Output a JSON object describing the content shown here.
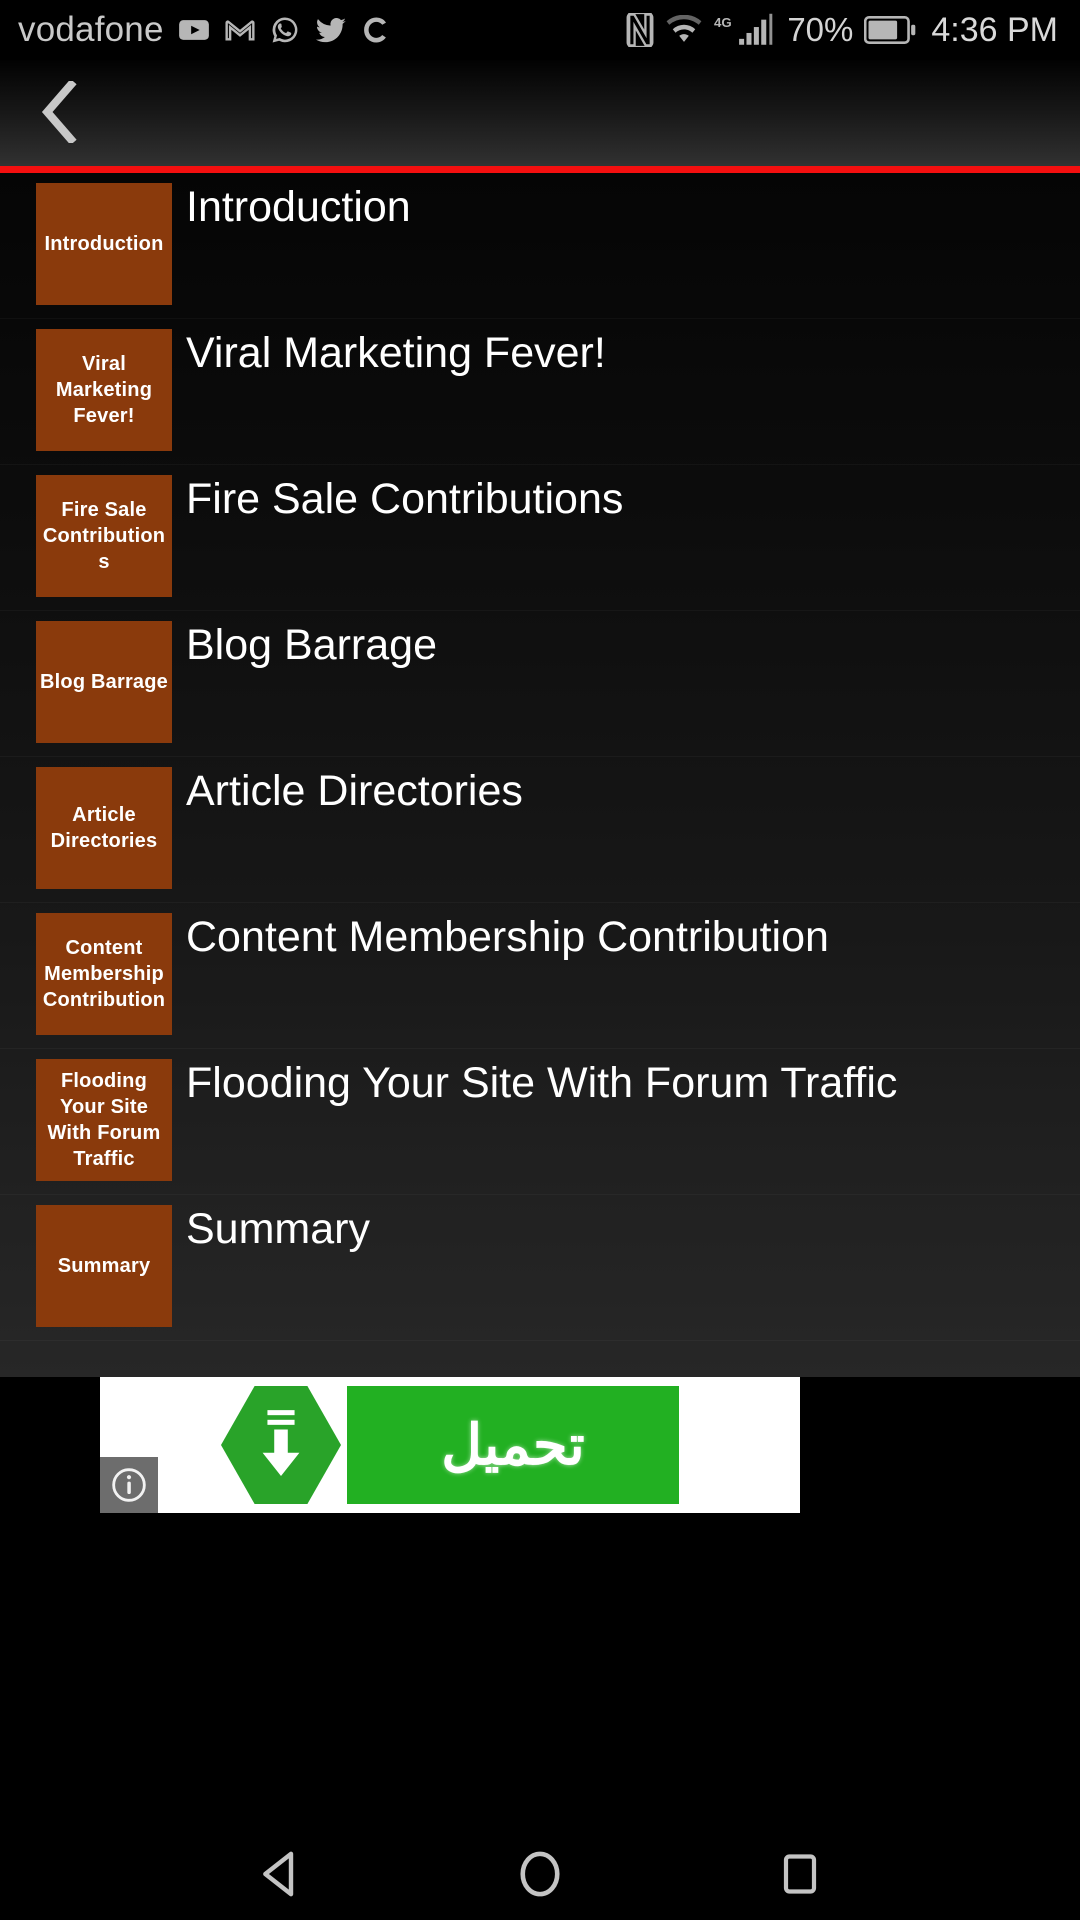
{
  "status_bar": {
    "carrier": "vodafone",
    "icons": [
      "youtube-icon",
      "gmail-icon",
      "whatsapp-icon",
      "twitter-icon",
      "chrome-c-icon"
    ],
    "right_icons": [
      "nfc-icon",
      "wifi-icon",
      "signal-4g-icon",
      "battery-icon"
    ],
    "network": "4G",
    "battery_percent": "70%",
    "time": "4:36 PM"
  },
  "app_bar": {
    "back_icon": "chevron-left-icon",
    "accent_color": "#f40f0f"
  },
  "colors": {
    "thumb_bg": "#8a3a0c",
    "accent_red": "#f40f0f",
    "ad_green": "#22b022"
  },
  "chapters": [
    {
      "thumb_label": "Introduction",
      "title": "Introduction"
    },
    {
      "thumb_label": "Viral Marketing Fever!",
      "title": "Viral Marketing Fever!"
    },
    {
      "thumb_label": "Fire Sale Contributions",
      "title": "Fire Sale Contributions"
    },
    {
      "thumb_label": "Blog Barrage",
      "title": "Blog Barrage"
    },
    {
      "thumb_label": "Article Directories",
      "title": "Article Directories"
    },
    {
      "thumb_label": "Content Membership Contribution",
      "title": "Content Membership Contribution"
    },
    {
      "thumb_label": "Flooding Your Site With Forum Traffic",
      "title": "Flooding Your Site With Forum Traffic"
    },
    {
      "thumb_label": "Summary",
      "title": "Summary"
    }
  ],
  "ad": {
    "button_text": "تحميل",
    "download_icon": "download-arrow-icon",
    "info_icon": "info-icon"
  },
  "nav_bar": {
    "back": "back-triangle-icon",
    "home": "home-circle-icon",
    "recents": "recents-square-icon"
  }
}
